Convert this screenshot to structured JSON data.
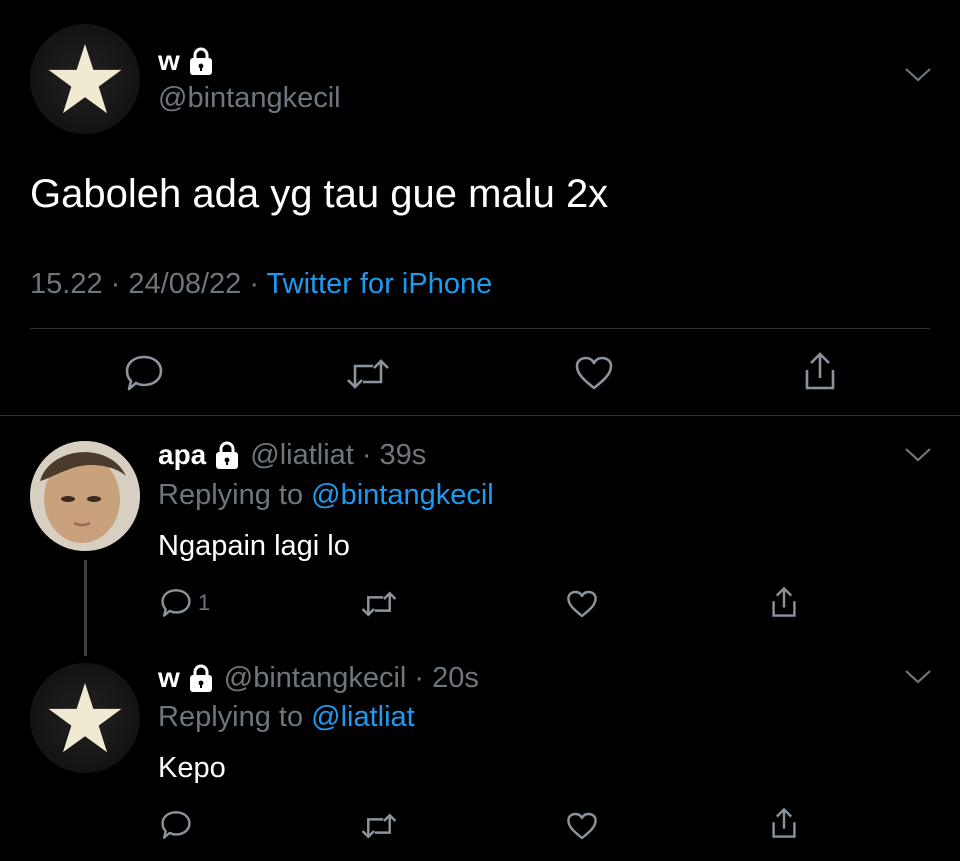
{
  "main_tweet": {
    "display_name": "w",
    "handle": "@bintangkecil",
    "text": "Gaboleh ada yg tau gue malu 2x",
    "time": "15.22",
    "separator": "·",
    "date": "24/08/22",
    "source": "Twitter for iPhone",
    "avatar_icon": "star-icon"
  },
  "replies": [
    {
      "display_name": "apa",
      "handle": "@liatliat",
      "separator": "·",
      "time": "39s",
      "replying_prefix": "Replying to",
      "replying_to": "@bintangkecil",
      "text": "Ngapain lagi lo",
      "reply_count": "1"
    },
    {
      "display_name": "w",
      "handle": "@bintangkecil",
      "separator": "·",
      "time": "20s",
      "replying_prefix": "Replying to",
      "replying_to": "@liatliat",
      "text": "Kepo",
      "avatar_icon": "star-icon"
    }
  ],
  "colors": {
    "background": "#000000",
    "accent": "#1d9bf0",
    "secondary_text": "#6e767d",
    "divider": "#2f3336"
  }
}
